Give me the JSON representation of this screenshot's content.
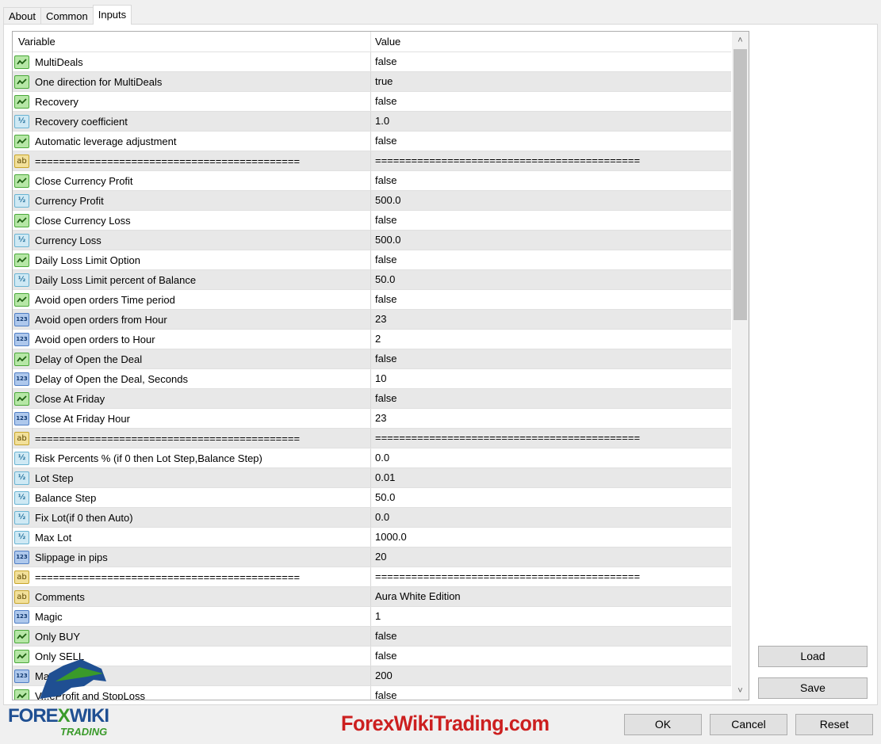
{
  "tabs": [
    {
      "label": "About"
    },
    {
      "label": "Common"
    },
    {
      "label": "Inputs"
    }
  ],
  "table": {
    "headers": {
      "variable": "Variable",
      "value": "Value"
    },
    "rows": [
      {
        "icon": "bool",
        "name": "MultiDeals",
        "value": "false"
      },
      {
        "icon": "bool",
        "name": "One direction for MultiDeals",
        "value": "true"
      },
      {
        "icon": "bool",
        "name": "Recovery",
        "value": "false"
      },
      {
        "icon": "double",
        "name": "Recovery coefficient",
        "value": "1.0"
      },
      {
        "icon": "bool",
        "name": "Automatic leverage adjustment",
        "value": "false"
      },
      {
        "icon": "string",
        "name": "============================================",
        "value": "============================================"
      },
      {
        "icon": "bool",
        "name": "Close Currency Profit",
        "value": "false"
      },
      {
        "icon": "double",
        "name": "Currency Profit",
        "value": "500.0"
      },
      {
        "icon": "bool",
        "name": "Close Currency Loss",
        "value": "false"
      },
      {
        "icon": "double",
        "name": "Currency Loss",
        "value": "500.0"
      },
      {
        "icon": "bool",
        "name": "Daily Loss Limit Option",
        "value": "false"
      },
      {
        "icon": "double",
        "name": "Daily Loss Limit percent of Balance",
        "value": "50.0"
      },
      {
        "icon": "bool",
        "name": "Avoid open orders Time period",
        "value": "false"
      },
      {
        "icon": "int",
        "name": "Avoid open orders from Hour",
        "value": "23"
      },
      {
        "icon": "int",
        "name": "Avoid open orders to Hour",
        "value": "2"
      },
      {
        "icon": "bool",
        "name": "Delay of Open the Deal",
        "value": "false"
      },
      {
        "icon": "int",
        "name": "Delay of Open the Deal, Seconds",
        "value": "10"
      },
      {
        "icon": "bool",
        "name": "Close At Friday",
        "value": "false"
      },
      {
        "icon": "int",
        "name": "Close At Friday Hour",
        "value": "23"
      },
      {
        "icon": "string",
        "name": "============================================",
        "value": "============================================"
      },
      {
        "icon": "double",
        "name": "Risk Percents % (if 0 then Lot Step,Balance Step)",
        "value": "0.0"
      },
      {
        "icon": "double",
        "name": "Lot Step",
        "value": "0.01"
      },
      {
        "icon": "double",
        "name": "Balance Step",
        "value": "50.0"
      },
      {
        "icon": "double",
        "name": "Fix Lot(if 0 then Auto)",
        "value": "0.0"
      },
      {
        "icon": "double",
        "name": "Max Lot",
        "value": "1000.0"
      },
      {
        "icon": "int",
        "name": "Slippage in pips",
        "value": "20"
      },
      {
        "icon": "string",
        "name": "============================================",
        "value": "============================================"
      },
      {
        "icon": "string",
        "name": "Comments",
        "value": "Aura White Edition"
      },
      {
        "icon": "int",
        "name": "Magic",
        "value": "1"
      },
      {
        "icon": "bool",
        "name": "Only BUY",
        "value": "false"
      },
      {
        "icon": "bool",
        "name": "Only SELL",
        "value": "false"
      },
      {
        "icon": "int",
        "name": "Ma",
        "value": "200"
      },
      {
        "icon": "bool",
        "name": "V...eProfit and StopLoss",
        "value": "false"
      }
    ]
  },
  "icon_glyphs": {
    "bool": "",
    "double": "½",
    "int": "123",
    "string": "ab"
  },
  "buttons": {
    "load": "Load",
    "save": "Save",
    "ok": "OK",
    "cancel": "Cancel",
    "reset": "Reset"
  },
  "watermark": {
    "text": "ForexWikiTrading.com",
    "color": "#cc1f1f"
  },
  "logo": {
    "main_a": "FORE",
    "main_x": "X",
    "main_b": "WIKI",
    "sub": "TRADING"
  },
  "colors": {
    "bool_icon": "#b6e7a6",
    "double_icon": "#cfe9f4",
    "int_icon": "#aec8ec",
    "string_icon": "#f2e09a",
    "row_alt": "#e8e8e8"
  }
}
